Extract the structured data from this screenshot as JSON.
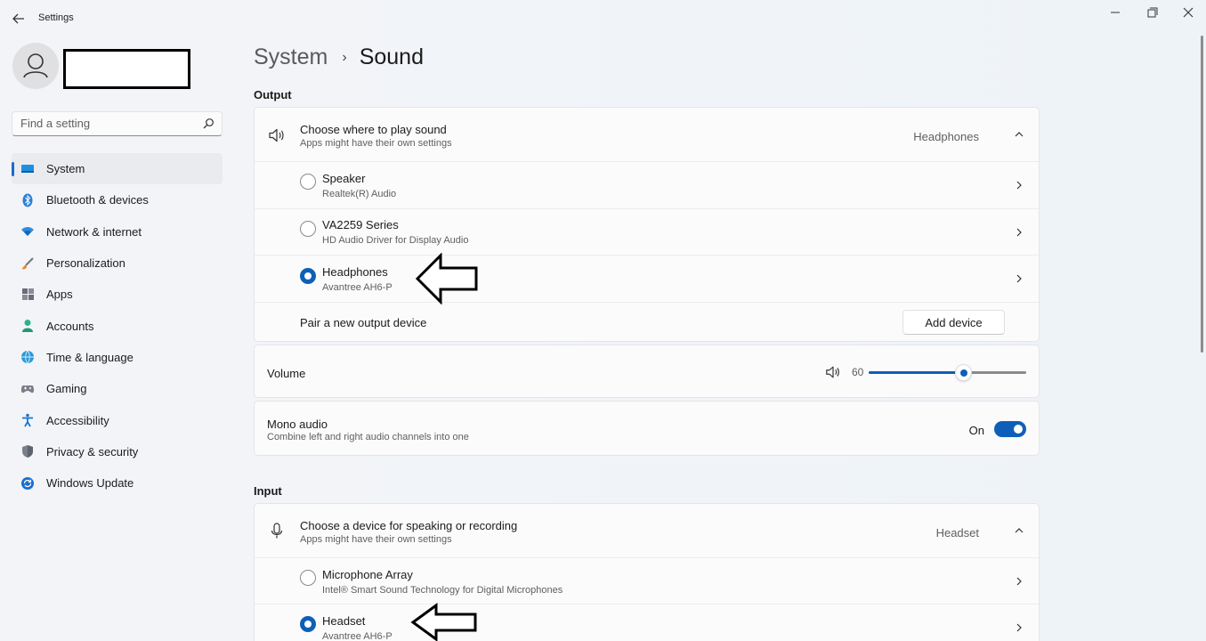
{
  "window": {
    "title": "Settings"
  },
  "search": {
    "placeholder": "Find a setting"
  },
  "sidebar": {
    "items": [
      {
        "label": "System",
        "icon": "system-icon",
        "active": true
      },
      {
        "label": "Bluetooth & devices",
        "icon": "bluetooth-icon"
      },
      {
        "label": "Network & internet",
        "icon": "wifi-icon"
      },
      {
        "label": "Personalization",
        "icon": "brush-icon"
      },
      {
        "label": "Apps",
        "icon": "apps-icon"
      },
      {
        "label": "Accounts",
        "icon": "accounts-icon"
      },
      {
        "label": "Time & language",
        "icon": "globe-icon"
      },
      {
        "label": "Gaming",
        "icon": "gamepad-icon"
      },
      {
        "label": "Accessibility",
        "icon": "accessibility-icon"
      },
      {
        "label": "Privacy & security",
        "icon": "shield-icon"
      },
      {
        "label": "Windows Update",
        "icon": "update-icon"
      }
    ]
  },
  "breadcrumb": {
    "parent": "System",
    "separator": "›",
    "current": "Sound"
  },
  "output": {
    "heading": "Output",
    "choose": {
      "title": "Choose where to play sound",
      "subtitle": "Apps might have their own settings",
      "selected": "Headphones"
    },
    "devices": [
      {
        "name": "Speaker",
        "detail": "Realtek(R) Audio",
        "checked": false
      },
      {
        "name": "VA2259 Series",
        "detail": "HD Audio Driver for Display Audio",
        "checked": false
      },
      {
        "name": "Headphones",
        "detail": "Avantree AH6-P",
        "checked": true
      }
    ],
    "pair": {
      "label": "Pair a new output device",
      "button": "Add device"
    },
    "volume": {
      "label": "Volume",
      "value": "60",
      "level": 60
    },
    "mono": {
      "title": "Mono audio",
      "subtitle": "Combine left and right audio channels into one",
      "state": "On"
    }
  },
  "input": {
    "heading": "Input",
    "choose": {
      "title": "Choose a device for speaking or recording",
      "subtitle": "Apps might have their own settings",
      "selected": "Headset"
    },
    "devices": [
      {
        "name": "Microphone Array",
        "detail": "Intel® Smart Sound Technology for Digital Microphones",
        "checked": false
      },
      {
        "name": "Headset",
        "detail": "Avantree AH6-P",
        "checked": true
      }
    ]
  },
  "colors": {
    "accent": "#0f5fb8"
  }
}
